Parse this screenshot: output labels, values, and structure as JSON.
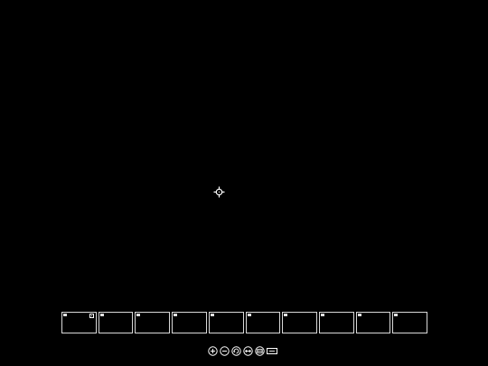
{
  "hotbar": {
    "slot_count": 10,
    "selected_slot": 1
  },
  "toolbar": {
    "buttons": [
      {
        "name": "zoom-in-icon"
      },
      {
        "name": "zoom-out-icon"
      },
      {
        "name": "rotate-icon"
      },
      {
        "name": "pan-horizontal-icon"
      },
      {
        "name": "fit-view-icon"
      },
      {
        "name": "keyboard-icon"
      }
    ]
  },
  "colors": {
    "background": "#000000",
    "foreground": "#ffffff",
    "slot_border": "#d8d8d8"
  }
}
